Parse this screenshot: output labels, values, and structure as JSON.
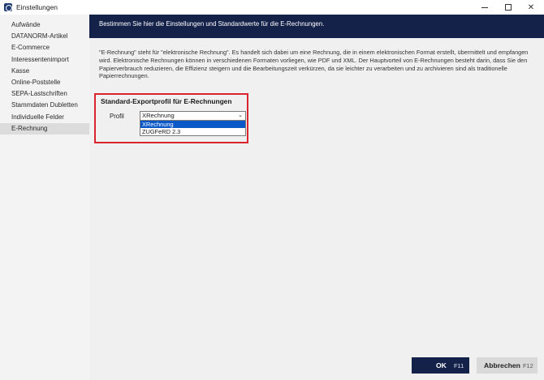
{
  "window": {
    "title": "Einstellungen",
    "icons": {
      "app": "settings-app-icon",
      "minimize": "minimize-icon",
      "maximize": "maximize-icon",
      "close": "close-icon"
    }
  },
  "sidebar": {
    "items": [
      {
        "label": "Aufwände"
      },
      {
        "label": "DATANORM-Artikel"
      },
      {
        "label": "E-Commerce"
      },
      {
        "label": "Interessentenimport"
      },
      {
        "label": "Kasse"
      },
      {
        "label": "Online-Poststelle"
      },
      {
        "label": "SEPA-Lastschriften"
      },
      {
        "label": "Stammdaten Dubletten"
      },
      {
        "label": "Individuelle Felder"
      },
      {
        "label": "E-Rechnung"
      }
    ],
    "active_index": 9
  },
  "main": {
    "banner": "Bestimmen Sie hier die Einstellungen und Standardwerte für die E-Rechnungen.",
    "description": "\"E-Rechnung\" steht für \"elektronische Rechnung\". Es handelt sich dabei um eine Rechnung, die in einem elektronischen Format erstellt, übermittelt und empfangen wird. Elektronische Rechnungen können in verschiedenen Formaten vorliegen, wie PDF und XML. Der Hauptvorteil von E-Rechnungen besteht darin, dass Sie den Papierverbrauch reduzieren, die Effizienz steigern und die Bearbeitungszeit verkürzen, da sie leichter zu verarbeiten und zu archivieren sind als traditionelle Papierrechnungen.",
    "group": {
      "title": "Standard-Exportprofil für E-Rechnungen",
      "profile_label": "Profil",
      "selected_value": "XRechnung",
      "options": [
        "XRechnung",
        "ZUGFeRD 2.3"
      ]
    }
  },
  "footer": {
    "ok_label": "OK",
    "ok_key": "F11",
    "cancel_label": "Abbrechen",
    "cancel_key": "F12"
  },
  "colors": {
    "banner_bg": "#14224a",
    "highlight_border": "#d9232d",
    "selection": "#0a58c8"
  }
}
